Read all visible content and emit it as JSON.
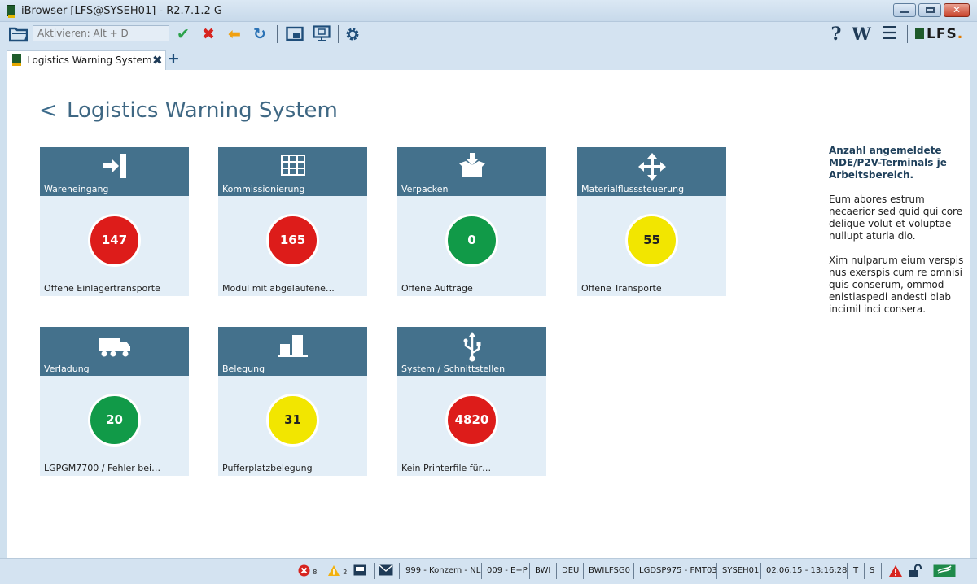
{
  "window": {
    "title": "iBrowser [LFS@SYSEH01] - R2.7.1.2 G"
  },
  "toolbar": {
    "address_placeholder": "Aktivieren: Alt + D",
    "help_label": "?",
    "wiki_label": "W",
    "logo_text": "LFS",
    "logo_dot": "."
  },
  "tab": {
    "label": "Logistics Warning System"
  },
  "page": {
    "back_glyph": "<",
    "title": "Logistics Warning System"
  },
  "tiles": [
    {
      "title": "Wareneingang",
      "value": "147",
      "subtitle": "Offene Einlagertransporte",
      "status": "red",
      "icon": "inbound-icon"
    },
    {
      "title": "Kommissionierung",
      "value": "165",
      "subtitle": "Modul mit abgelaufene…",
      "status": "red",
      "icon": "picking-icon"
    },
    {
      "title": "Verpacken",
      "value": "0",
      "subtitle": "Offene Aufträge",
      "status": "green",
      "icon": "packing-icon"
    },
    {
      "title": "Materialflusssteuerung",
      "value": "55",
      "subtitle": "Offene Transporte",
      "status": "yellow",
      "icon": "material-flow-icon"
    },
    {
      "title": "Verladung",
      "value": "20",
      "subtitle": "LGPGM7700 / Fehler bei…",
      "status": "green",
      "icon": "truck-icon"
    },
    {
      "title": "Belegung",
      "value": "31",
      "subtitle": "Pufferplatzbelegung",
      "status": "yellow",
      "icon": "occupancy-icon"
    },
    {
      "title": "System / Schnittstellen",
      "value": "4820",
      "subtitle": "Kein Printerfile für…",
      "status": "red",
      "icon": "usb-icon"
    }
  ],
  "info": {
    "heading": "Anzahl angemeldete MDE/P2V-Terminals je Arbeitsbereich.",
    "para1": "Eum abores estrum necaerior sed quid qui core delique volut et voluptae nullupt aturia dio.",
    "para2": "Xim nulparum eium verspis nus exerspis cum re omnisi quis conserum, ommod enistiaspedi andesti blab incimil inci consera."
  },
  "status": {
    "errors": "8",
    "warnings": "2",
    "company": "999 - Konzern - NL",
    "site": "009 - E+P",
    "code": "BWI",
    "lang": "DEU",
    "user": "BWILFSG0",
    "printer": "LGDSP975 - FMT03",
    "host": "SYSEH01",
    "datetime": "02.06.15 - 13:16:28",
    "t": "T",
    "s": "S"
  },
  "colors": {
    "red": "#dd1c1a",
    "green": "#119a48",
    "yellow": "#f2e600",
    "tile_header": "#44718c",
    "tile_body": "#e3eef7"
  }
}
